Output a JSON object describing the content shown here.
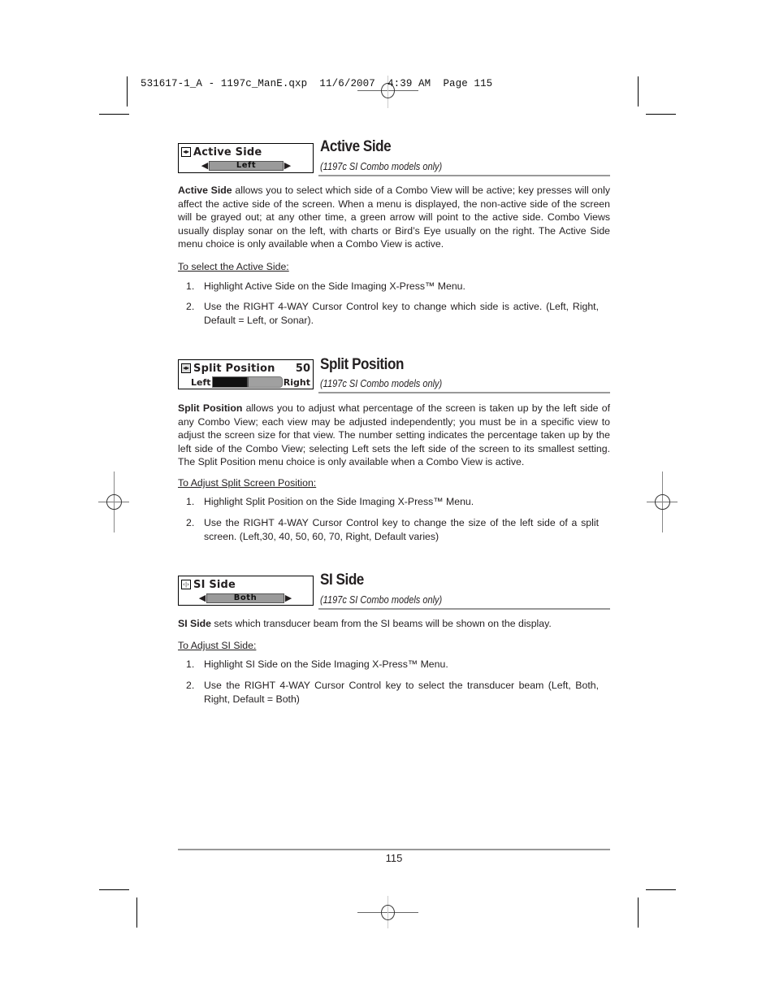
{
  "slug": "531617-1_A - 1197c_ManE.qxp  11/6/2007  4:39 AM  Page 115",
  "sections": [
    {
      "menu": {
        "icon": "left-right-arrows-icon",
        "icon_glyph": "◂▸",
        "title": "Active Side",
        "type": "selector",
        "value": "Left",
        "left_arrow": "◀",
        "right_arrow": "▶"
      },
      "title": "Active Side",
      "subtitle": "(1197c SI Combo models only)",
      "body_lead": "Active Side",
      "body": " allows you to select which side of a Combo View will be active; key presses will only affect the active side of the screen. When a menu is displayed, the non-active side of the screen will be grayed out; at any other time, a green arrow will point to the active side. Combo Views usually display sonar on the left, with charts or Bird’s Eye usually on the right. The Active Side menu choice is only available when a Combo View is active.",
      "procedure": "To select the Active Side:",
      "steps": [
        {
          "num": "1.",
          "text": "Highlight Active Side on the Side Imaging X-Press™ Menu."
        },
        {
          "num": "2.",
          "text": "Use the RIGHT 4-WAY Cursor Control key to change which side is active. (Left, Right, Default = Left, or Sonar)."
        }
      ]
    },
    {
      "menu": {
        "icon": "split-screen-icon",
        "icon_glyph": "◂▸",
        "title": "Split Position",
        "type": "slider",
        "value": "50",
        "slider_fraction": 0.5,
        "left_label": "Left",
        "right_label": "Right"
      },
      "title": "Split Position",
      "subtitle": "(1197c SI Combo models only)",
      "body_lead": "Split Position",
      "body": " allows you to adjust what percentage of the screen is taken up by the left side of any Combo View; each view may be adjusted independently; you must be in a specific view to adjust the screen size for that view. The number setting indicates the percentage taken up by the left side of the Combo View; selecting Left sets the left side of the screen to its smallest setting. The Split Position menu choice is only available when a Combo View is active.",
      "procedure": "To Adjust Split Screen Position:",
      "steps": [
        {
          "num": "1.",
          "text": "Highlight Split Position on the Side Imaging X-Press™ Menu."
        },
        {
          "num": "2.",
          "text": "Use the RIGHT 4-WAY Cursor Control key to change the size of the left side of a split screen. (Left,30, 40, 50, 60, 70, Right, Default varies)"
        }
      ]
    },
    {
      "menu": {
        "icon": "si-beam-icon",
        "icon_glyph": "‹|›",
        "title": "SI Side",
        "type": "selector",
        "value": "Both",
        "left_arrow": "◀",
        "right_arrow": "▶"
      },
      "title": "SI Side",
      "subtitle": "(1197c SI Combo models only)",
      "body_lead": "SI Side",
      "body": " sets which transducer beam from the SI beams will be shown on the display.",
      "procedure": "To Adjust SI Side:",
      "steps": [
        {
          "num": "1.",
          "text": "Highlight SI Side on the Side Imaging X-Press™ Menu."
        },
        {
          "num": "2.",
          "text": "Use the RIGHT 4-WAY Cursor Control key to select the transducer beam (Left, Both, Right, Default = Both)"
        }
      ]
    }
  ],
  "page_number": "115"
}
